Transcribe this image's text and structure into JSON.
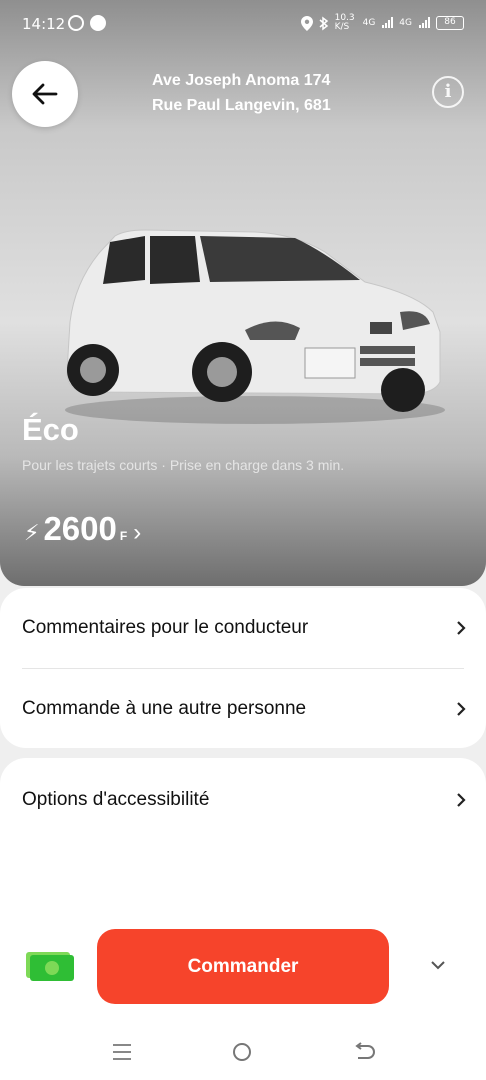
{
  "status_bar": {
    "time": "14:12",
    "network_speed": "10.3 K/S",
    "signal_1": "4G",
    "signal_2": "4G",
    "battery": "86"
  },
  "header": {
    "route_from": "Ave Joseph Anoma 174",
    "route_to": "Rue Paul Langevin, 681",
    "info_label": "i"
  },
  "tariff": {
    "name": "Éco",
    "description": "Pour les trajets courts · Prise en charge dans 3 min.",
    "price_icon": "⚡",
    "price": "2600",
    "currency": "F",
    "price_chevron": "›"
  },
  "options": [
    {
      "label": "Commentaires pour le conducteur"
    },
    {
      "label": "Commande à une autre personne"
    },
    {
      "label": "Options d'accessibilité"
    }
  ],
  "footer": {
    "payment_icon": "cash-icon",
    "order_label": "Commander"
  },
  "colors": {
    "accent": "#f6442b",
    "card_bg": "#ffffff",
    "cash_green": "#2fbe35"
  }
}
